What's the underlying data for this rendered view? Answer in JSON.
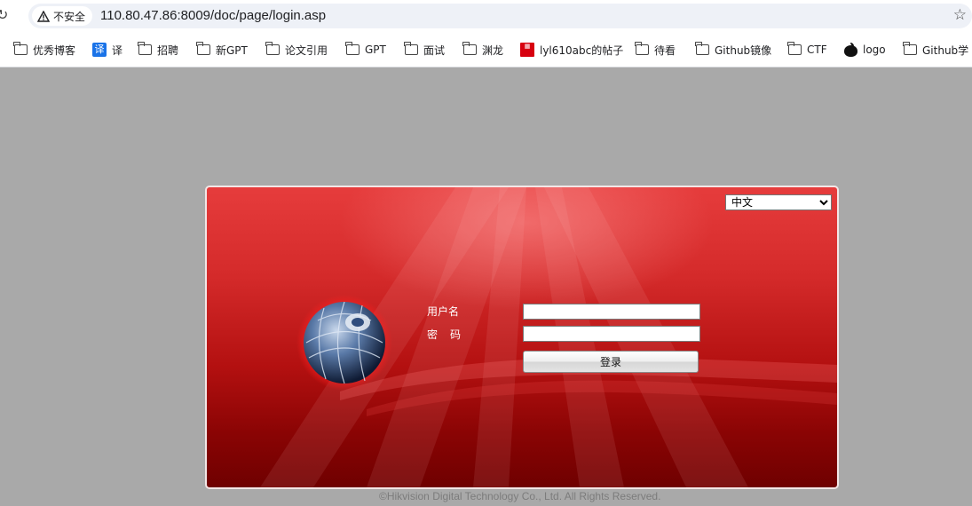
{
  "browser": {
    "security_label": "不安全",
    "url": "110.80.47.86:8009/doc/page/login.asp"
  },
  "bookmarks": [
    {
      "label": "优秀博客",
      "icon": "folder-icon"
    },
    {
      "label": "译",
      "icon": "translate-icon"
    },
    {
      "label": "招聘",
      "icon": "folder-icon"
    },
    {
      "label": "新GPT",
      "icon": "folder-icon"
    },
    {
      "label": "论文引用",
      "icon": "folder-icon"
    },
    {
      "label": "GPT",
      "icon": "folder-icon"
    },
    {
      "label": "面试",
      "icon": "folder-icon"
    },
    {
      "label": "渊龙",
      "icon": "folder-icon"
    },
    {
      "label": "lyl610abc的帖子",
      "icon": "tieba-icon"
    },
    {
      "label": "待看",
      "icon": "folder-icon"
    },
    {
      "label": "Github镜像",
      "icon": "folder-icon"
    },
    {
      "label": "CTF",
      "icon": "folder-icon"
    },
    {
      "label": "logo",
      "icon": "apple-icon"
    },
    {
      "label": "Github学",
      "icon": "folder-icon"
    }
  ],
  "login": {
    "language_selected": "中文",
    "username_label": "用户名",
    "password_label": "密码",
    "username_value": "",
    "password_value": "",
    "login_button": "登录"
  },
  "footer": {
    "copyright": "©Hikvision Digital Technology Co., Ltd. All Rights Reserved."
  },
  "colors": {
    "page_bg": "#a9a9a9",
    "panel_top": "#e63c3c",
    "panel_bottom": "#6f0000"
  }
}
